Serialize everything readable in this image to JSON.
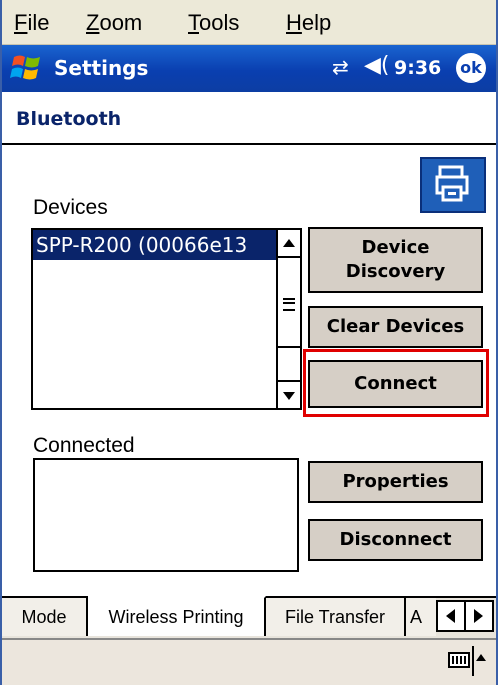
{
  "menubar": {
    "file": {
      "u": "F",
      "rest": "ile"
    },
    "zoom": {
      "u": "Z",
      "rest": "oom"
    },
    "tools": {
      "u": "T",
      "rest": "ools"
    },
    "help": {
      "u": "H",
      "rest": "elp"
    }
  },
  "titlebar": {
    "title": "Settings",
    "time": "9:36",
    "ok_label": "ok",
    "connectivity_icon": "⇄",
    "volume_icon": "◀("
  },
  "page": {
    "title": "Bluetooth"
  },
  "devices": {
    "label": "Devices",
    "selected_item": "SPP-R200 (00066e13"
  },
  "connected": {
    "label": "Connected"
  },
  "buttons": {
    "device_discovery_line1": "Device",
    "device_discovery_line2": "Discovery",
    "clear_devices": "Clear Devices",
    "connect": "Connect",
    "properties": "Properties",
    "disconnect": "Disconnect"
  },
  "tabs": [
    {
      "label": "Mode"
    },
    {
      "label": "Wireless Printing"
    },
    {
      "label": "File Transfer"
    },
    {
      "label": "A"
    }
  ],
  "colors": {
    "titlebar": "#0a3fb0",
    "selection": "#0a246a",
    "button_face": "#d6cfc6",
    "highlight_box": "#e00000"
  }
}
